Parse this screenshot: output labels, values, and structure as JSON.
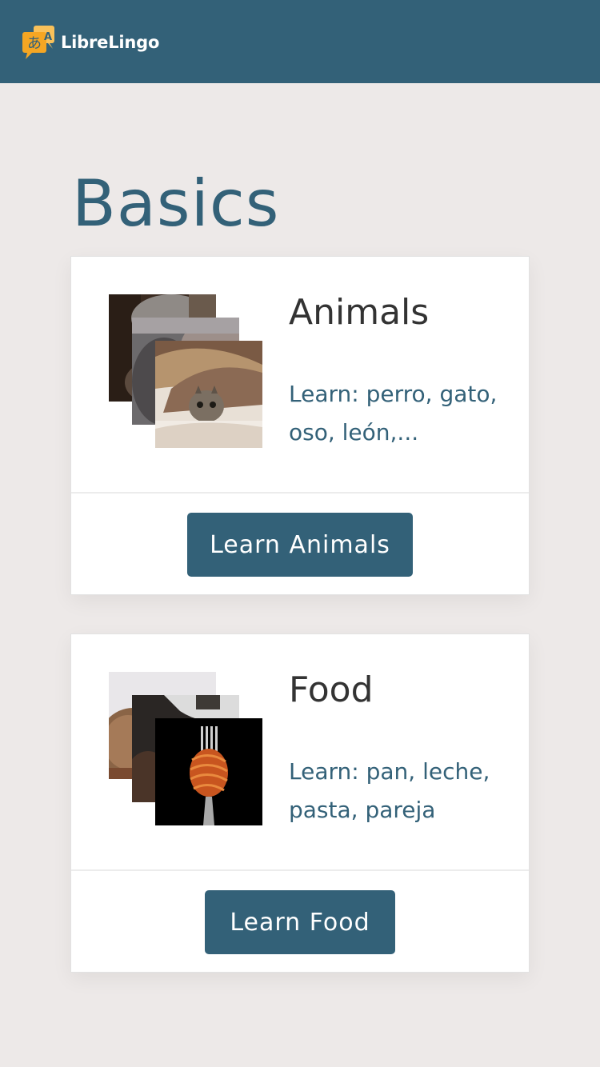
{
  "navbar": {
    "brand_name": "LibreLingo",
    "logo_icon": "speech-bubbles-logo-icon",
    "logo_glyph": "あ",
    "logo_color": "#f5a623",
    "background": "#336178"
  },
  "section": {
    "title": "Basics"
  },
  "skills": [
    {
      "title": "Animals",
      "description": "Learn: perro, gato, oso, león,...",
      "button_label": "Learn Animals",
      "images": [
        "dog-photo",
        "cat-photo",
        "kitten-in-blanket-photo"
      ]
    },
    {
      "title": "Food",
      "description": "Learn: pan, leche, pasta, pareja",
      "button_label": "Learn Food",
      "images": [
        "bread-photo",
        "milk-jug-photo",
        "pasta-on-fork-photo"
      ]
    }
  ],
  "colors": {
    "primary": "#336178",
    "page_background": "#ede9e8",
    "card_background": "#ffffff",
    "title_text": "#333333",
    "accent": "#f5a623"
  }
}
